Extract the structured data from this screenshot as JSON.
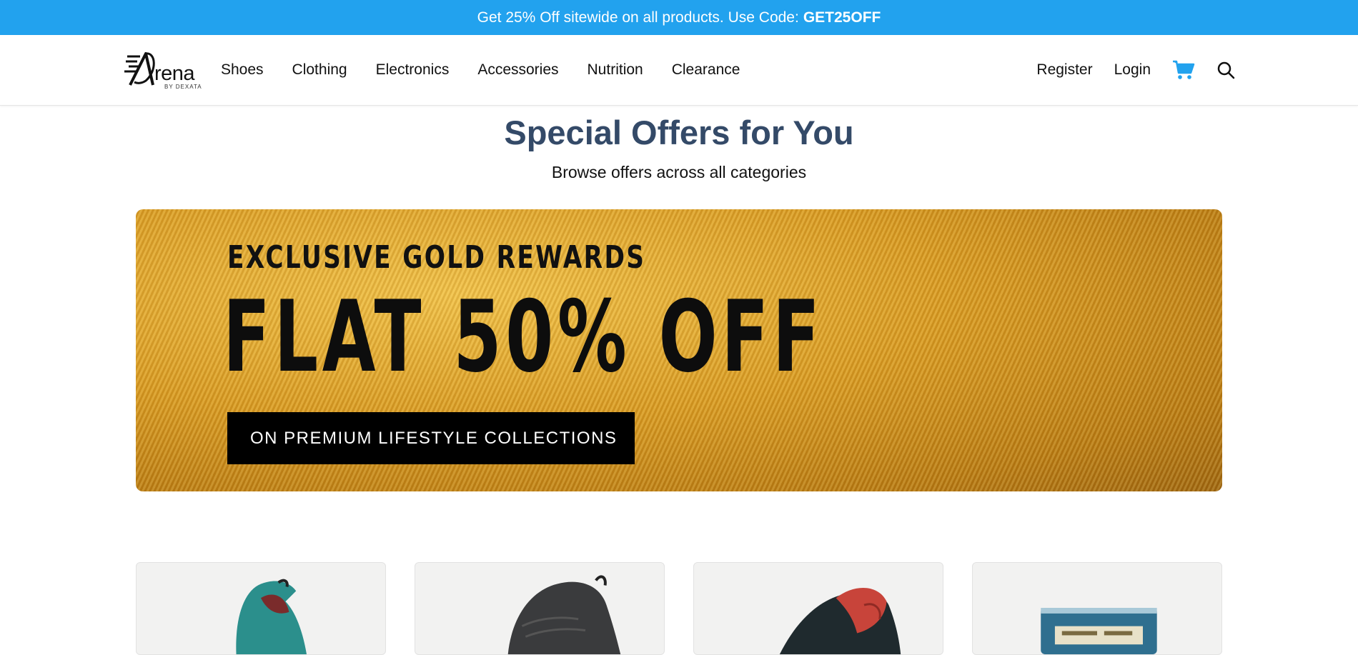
{
  "promo": {
    "text": "Get 25% Off sitewide on all products. Use Code:",
    "code": "GET25OFF"
  },
  "brand": {
    "name": "rena",
    "sub": "BY DEXATA"
  },
  "nav": {
    "links": [
      "Shoes",
      "Clothing",
      "Electronics",
      "Accessories",
      "Nutrition",
      "Clearance"
    ],
    "register": "Register",
    "login": "Login"
  },
  "icons": {
    "cart": "cart-icon",
    "search": "search-icon"
  },
  "colors": {
    "promo_bg": "#22a2ee",
    "title": "#344a68",
    "cart": "#22a2ee"
  },
  "page": {
    "title": "Special Offers for You",
    "subtitle": "Browse offers across all categories"
  },
  "banner": {
    "pre": "EXCLUSIVE GOLD REWARDS",
    "main": "FLAT 50% OFF",
    "tag": "ON PREMIUM LIFESTYLE COLLECTIONS"
  },
  "products": [
    {
      "image": "teal-red-sneaker"
    },
    {
      "image": "black-sneaker"
    },
    {
      "image": "red-black-running-shoe"
    },
    {
      "image": "nutrition-supplement-pack"
    }
  ]
}
